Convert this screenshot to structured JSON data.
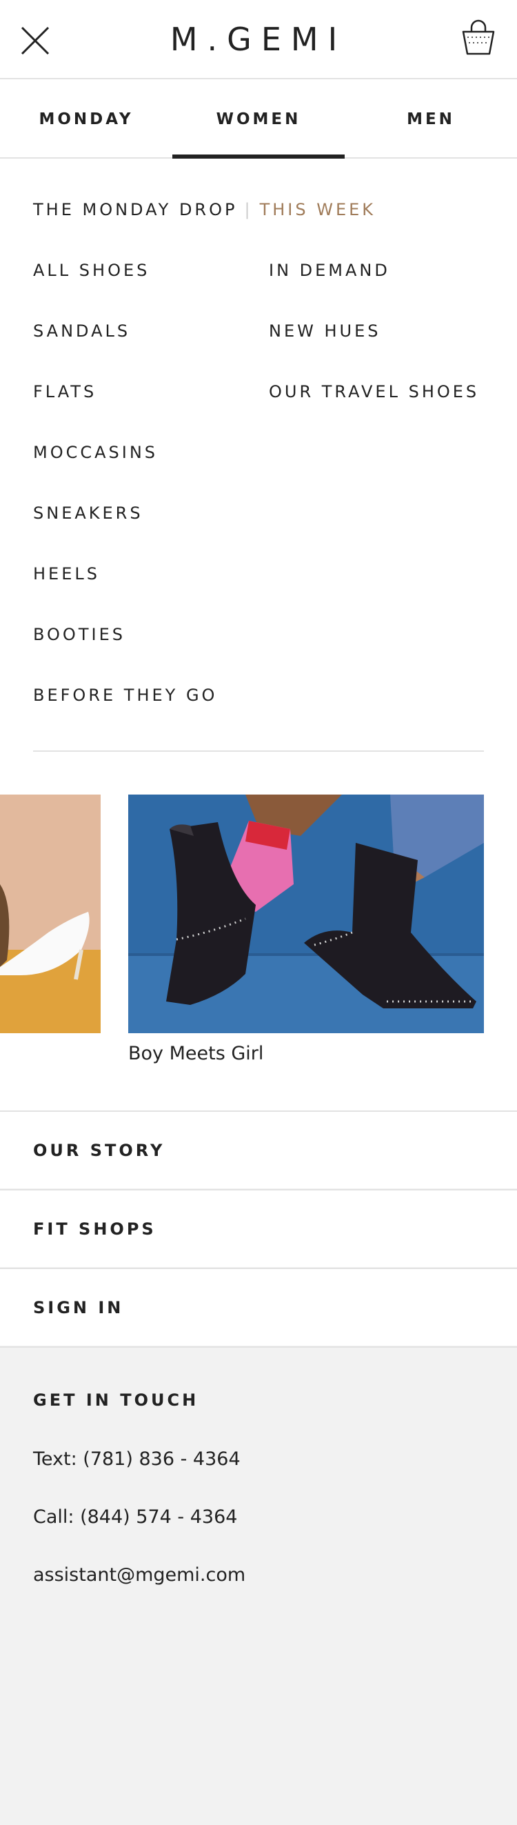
{
  "header": {
    "logo": "M.GEMI",
    "close_icon": "close-icon",
    "bag_icon": "shopping-bag-icon"
  },
  "tabs": [
    {
      "label": "MONDAY",
      "active": false
    },
    {
      "label": "WOMEN",
      "active": true
    },
    {
      "label": "MEN",
      "active": false
    }
  ],
  "menu": {
    "drop_label": "THE MONDAY DROP",
    "drop_separator": "|",
    "drop_accent": "THIS WEEK",
    "left_column": [
      "ALL SHOES",
      "SANDALS",
      "FLATS",
      "MOCCASINS",
      "SNEAKERS",
      "HEELS",
      "BOOTIES",
      "BEFORE THEY GO"
    ],
    "right_column": [
      "IN DEMAND",
      "NEW HUES",
      "OUR TRAVEL SHOES"
    ]
  },
  "featured": {
    "caption": "Boy Meets Girl"
  },
  "links": [
    "OUR STORY",
    "FIT SHOPS",
    "SIGN IN"
  ],
  "contact": {
    "title": "GET IN TOUCH",
    "text": "Text: (781) 836 - 4364",
    "call": "Call: (844) 574 - 4364",
    "email": "assistant@mgemi.com"
  },
  "colors": {
    "accent": "#a07c5a",
    "text": "#222222",
    "background": "#f2f2f2",
    "divider": "#e2e2e2"
  }
}
